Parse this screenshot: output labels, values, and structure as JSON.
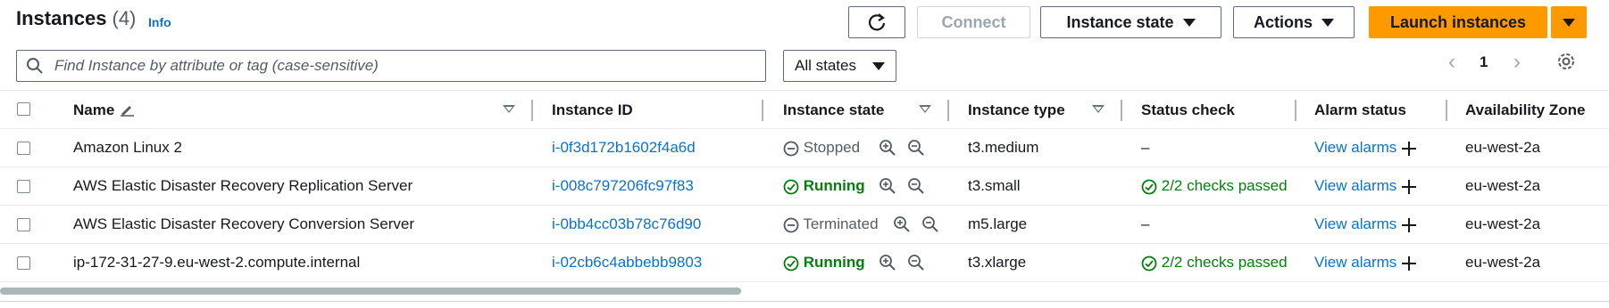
{
  "header": {
    "title": "Instances",
    "count": "(4)",
    "info": "Info",
    "connect_label": "Connect",
    "instance_state_label": "Instance state",
    "actions_label": "Actions",
    "launch_label": "Launch instances"
  },
  "filter": {
    "search_placeholder": "Find Instance by attribute or tag (case-sensitive)",
    "states_value": "All states"
  },
  "pagination": {
    "page": "1"
  },
  "table": {
    "columns": [
      "Name",
      "Instance ID",
      "Instance state",
      "Instance type",
      "Status check",
      "Alarm status",
      "Availability Zone"
    ],
    "rows": [
      {
        "name": "Amazon Linux 2",
        "id": "i-0f3d172b1602f4a6d",
        "state": "Stopped",
        "type": "t3.medium",
        "status": "–",
        "alarm": "View alarms",
        "az": "eu-west-2a"
      },
      {
        "name": "AWS Elastic Disaster Recovery Replication Server",
        "id": "i-008c797206fc97f83",
        "state": "Running",
        "type": "t3.small",
        "status": "2/2 checks passed",
        "alarm": "View alarms",
        "az": "eu-west-2a"
      },
      {
        "name": "AWS Elastic Disaster Recovery Conversion Server",
        "id": "i-0bb4cc03b78c76d90",
        "state": "Terminated",
        "type": "m5.large",
        "status": "–",
        "alarm": "View alarms",
        "az": "eu-west-2a"
      },
      {
        "name": "ip-172-31-27-9.eu-west-2.compute.internal",
        "id": "i-02cb6c4abbebb9803",
        "state": "Running",
        "type": "t3.xlarge",
        "status": "2/2 checks passed",
        "alarm": "View alarms",
        "az": "eu-west-2a"
      }
    ]
  },
  "colors": {
    "accent": "#ff9900",
    "link": "#0972d3",
    "success": "#037f0c"
  }
}
